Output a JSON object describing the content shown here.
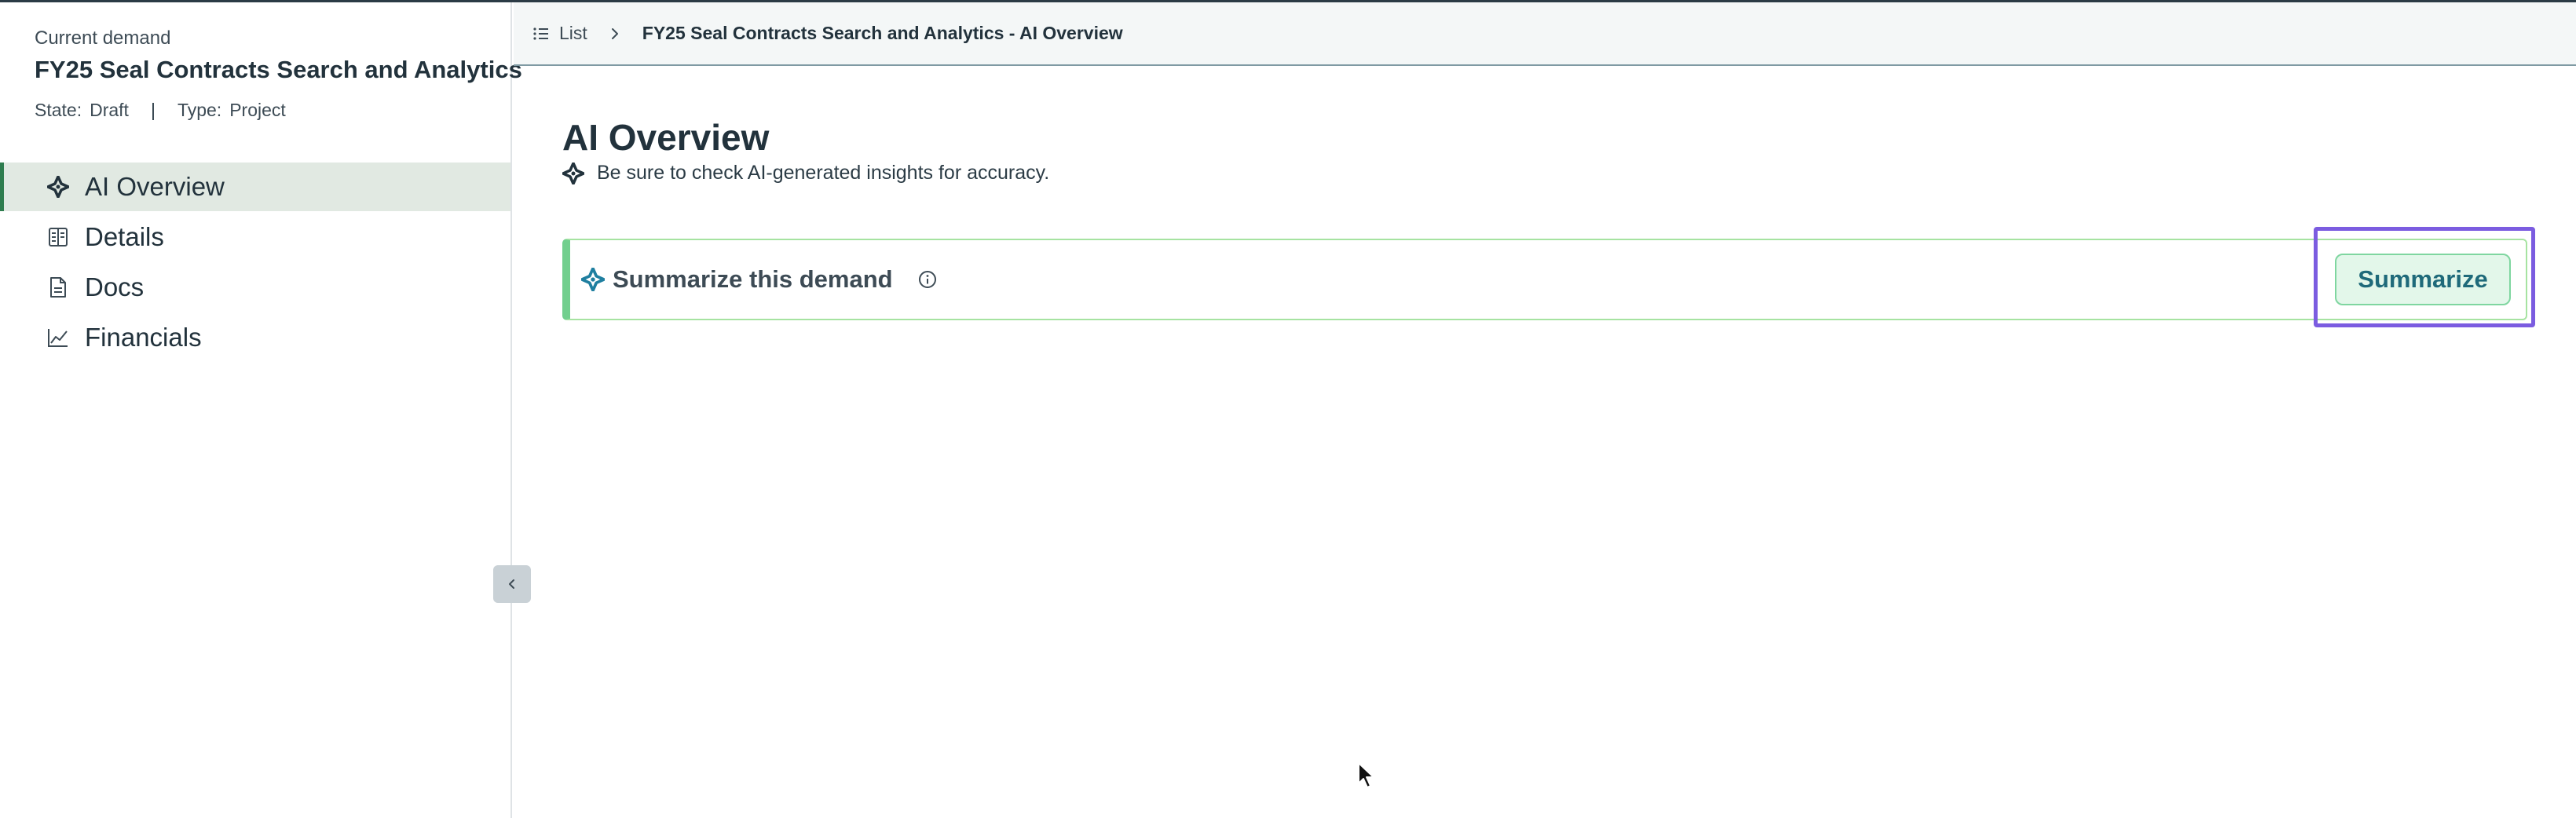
{
  "sidebar": {
    "caption": "Current demand",
    "title": "FY25 Seal Contracts Search and Analytics",
    "state_label": "State:",
    "state_value": "Draft",
    "separator": "|",
    "type_label": "Type:",
    "type_value": "Project",
    "items": [
      {
        "label": "AI Overview",
        "icon": "sparkle-icon",
        "active": true
      },
      {
        "label": "Details",
        "icon": "details-icon",
        "active": false
      },
      {
        "label": "Docs",
        "icon": "document-icon",
        "active": false
      },
      {
        "label": "Financials",
        "icon": "chart-line-icon",
        "active": false
      }
    ]
  },
  "header": {
    "list_label": "List",
    "current": "FY25 Seal Contracts Search and Analytics - AI Overview"
  },
  "main": {
    "title": "AI Overview",
    "disclaimer": "Be sure to check AI-generated insights for accuracy.",
    "card": {
      "title": "Summarize this demand",
      "button_label": "Summarize"
    }
  },
  "colors": {
    "accent_green": "#72cf8e",
    "active_nav_bg": "#e1e9e2",
    "highlight_purple": "#7b5ce0",
    "button_text": "#1f6a7a"
  }
}
